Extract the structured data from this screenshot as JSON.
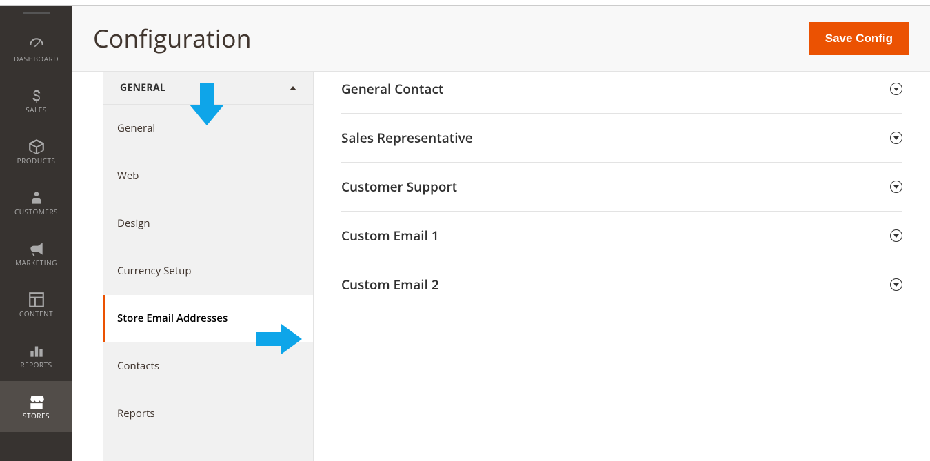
{
  "page": {
    "title": "Configuration",
    "save_button": "Save Config"
  },
  "admin_nav": [
    {
      "label": "DASHBOARD"
    },
    {
      "label": "SALES"
    },
    {
      "label": "PRODUCTS"
    },
    {
      "label": "CUSTOMERS"
    },
    {
      "label": "MARKETING"
    },
    {
      "label": "CONTENT"
    },
    {
      "label": "REPORTS"
    },
    {
      "label": "STORES"
    }
  ],
  "config_group": {
    "header": "GENERAL",
    "items": [
      {
        "label": "General"
      },
      {
        "label": "Web"
      },
      {
        "label": "Design"
      },
      {
        "label": "Currency Setup"
      },
      {
        "label": "Store Email Addresses"
      },
      {
        "label": "Contacts"
      },
      {
        "label": "Reports"
      }
    ]
  },
  "sections": [
    {
      "title": "General Contact"
    },
    {
      "title": "Sales Representative"
    },
    {
      "title": "Customer Support"
    },
    {
      "title": "Custom Email 1"
    },
    {
      "title": "Custom Email 2"
    }
  ]
}
